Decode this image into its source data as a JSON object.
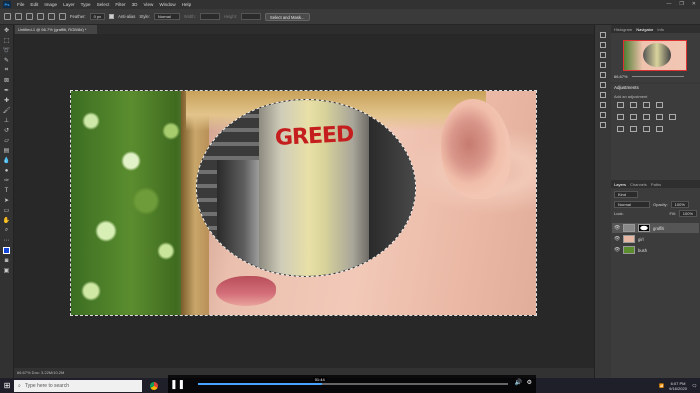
{
  "menubar": {
    "app_icon": "Ps",
    "items": [
      "File",
      "Edit",
      "Image",
      "Layer",
      "Type",
      "Select",
      "Filter",
      "3D",
      "View",
      "Window",
      "Help"
    ],
    "window_controls": [
      "—",
      "❐",
      "✕"
    ]
  },
  "options": {
    "feather_label": "Feather:",
    "feather_value": "0 px",
    "antialias_label": "Anti-alias",
    "style_label": "Style:",
    "style_value": "Normal",
    "width_label": "Width:",
    "height_label": "Height:",
    "select_mask_label": "Select and Mask..."
  },
  "document": {
    "tab_title": "Untitled-1 @ 66.7% (graffiti, RGB/8#) *",
    "graffiti_text": "GREED"
  },
  "panels": {
    "nav_tabs": [
      "Histogram",
      "Navigator",
      "Info"
    ],
    "zoom": "66.67%",
    "adjustments_title": "Adjustments",
    "adjustments_sub": "Add an adjustment",
    "layers_tabs": [
      "Layers",
      "Channels",
      "Paths"
    ],
    "kind_label": "Kind",
    "blend_mode": "Normal",
    "opacity_label": "Opacity:",
    "opacity_value": "100%",
    "lock_label": "Lock:",
    "fill_label": "Fill:",
    "fill_value": "100%",
    "layers": [
      "graffiti",
      "girl",
      "bush"
    ]
  },
  "status": {
    "text": "66.67%   Doc: 3.22M/10.2M"
  },
  "taskbar": {
    "search_placeholder": "Type here to search",
    "time": "6:07 PM",
    "date": "9/16/2020"
  },
  "video": {
    "time": "01:44",
    "progress": 0.4
  }
}
